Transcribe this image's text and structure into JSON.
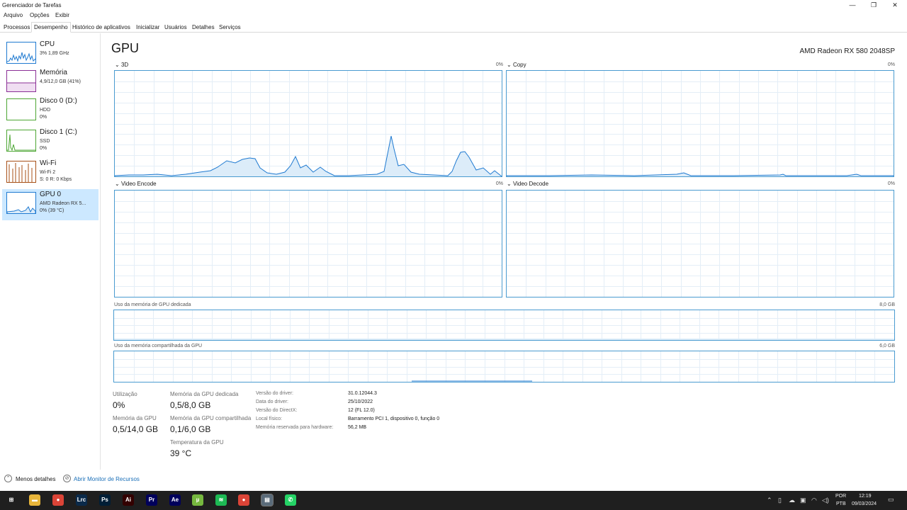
{
  "window": {
    "title": "Gerenciador de Tarefas",
    "controls": {
      "minimize": "—",
      "restore": "❐",
      "close": "✕"
    }
  },
  "menu": [
    "Arquivo",
    "Opções",
    "Exibir"
  ],
  "tabs": [
    "Processos",
    "Desempenho",
    "Histórico de aplicativos",
    "Inicializar",
    "Usuários",
    "Detalhes",
    "Serviços"
  ],
  "sidebar": {
    "items": [
      {
        "name": "CPU",
        "lines": [
          "3% 1,89 GHz"
        ]
      },
      {
        "name": "Memória",
        "lines": [
          "4,9/12,0 GB (41%)"
        ]
      },
      {
        "name": "Disco 0 (D:)",
        "lines": [
          "HDD",
          "0%"
        ]
      },
      {
        "name": "Disco 1 (C:)",
        "lines": [
          "SSD",
          "0%"
        ]
      },
      {
        "name": "Wi-Fi",
        "lines": [
          "Wi-Fi 2",
          "S: 0 R: 0 Kbps"
        ]
      },
      {
        "name": "GPU 0",
        "lines": [
          "AMD Radeon RX 5...",
          "0% (39 °C)"
        ]
      }
    ],
    "colors": {
      "cpu": "#1f7ad1",
      "memory": "#8b2f96",
      "disk": "#4da633",
      "wifi": "#a74f16",
      "gpu": "#1f7ad1"
    }
  },
  "main": {
    "title": "GPU",
    "device": "AMD Radeon RX 580 2048SP",
    "graphs": [
      {
        "label": "3D",
        "max": "0%"
      },
      {
        "label": "Copy",
        "max": "0%"
      },
      {
        "label": "Video Encode",
        "max": "0%"
      },
      {
        "label": "Video Decode",
        "max": "0%"
      }
    ],
    "dedicated_label": "Uso da memória de GPU dedicada",
    "dedicated_max": "8,0 GB",
    "shared_label": "Uso da memória compartilhada da GPU",
    "shared_max": "6,0 GB"
  },
  "stats": {
    "utilization_label": "Utilização",
    "utilization_value": "0%",
    "gpu_memory_label": "Memória da GPU",
    "gpu_memory_value": "0,5/14,0 GB",
    "dedicated_label": "Memória da GPU dedicada",
    "dedicated_value": "0,5/8,0 GB",
    "shared_label": "Memória da GPU compartilhada",
    "shared_value": "0,1/6,0 GB",
    "temp_label": "Temperatura da GPU",
    "temp_value": "39 °C"
  },
  "info": [
    {
      "key": "Versão do driver:",
      "value": "31.0.12044.3"
    },
    {
      "key": "Data do driver:",
      "value": "25/10/2022"
    },
    {
      "key": "Versão do DirectX:",
      "value": "12 (FL 12.0)"
    },
    {
      "key": "Local físico:",
      "value": "Barramento PCI 1, dispositivo 0, função 0"
    },
    {
      "key": "Memória reservada para hardware:",
      "value": "56,2 MB"
    }
  ],
  "footer": {
    "less_details": "Menos detalhes",
    "resource_monitor": "Abrir Monitor de Recursos"
  },
  "taskbar": {
    "icons": [
      {
        "name": "start",
        "glyph": "⊞",
        "color": "#1f1f1f"
      },
      {
        "name": "file-explorer",
        "glyph": "▬",
        "color": "#e8b53a"
      },
      {
        "name": "chrome",
        "glyph": "●",
        "color": "#db4437"
      },
      {
        "name": "lightroom-classic",
        "glyph": "Lrc",
        "color": "#0b2a4a"
      },
      {
        "name": "photoshop",
        "glyph": "Ps",
        "color": "#001e36"
      },
      {
        "name": "illustrator",
        "glyph": "Ai",
        "color": "#330000"
      },
      {
        "name": "premiere",
        "glyph": "Pr",
        "color": "#00005b"
      },
      {
        "name": "after-effects",
        "glyph": "Ae",
        "color": "#00005b"
      },
      {
        "name": "utorrent",
        "glyph": "µ",
        "color": "#76b83f"
      },
      {
        "name": "spotify",
        "glyph": "≋",
        "color": "#1db954"
      },
      {
        "name": "chrome-2",
        "glyph": "●",
        "color": "#db4437"
      },
      {
        "name": "task-manager",
        "glyph": "▤",
        "color": "#5a6b7a"
      },
      {
        "name": "whatsapp",
        "glyph": "✆",
        "color": "#25d366"
      }
    ],
    "language": "POR",
    "layout": "PTB",
    "time": "12:19",
    "date": "09/03/2024"
  }
}
